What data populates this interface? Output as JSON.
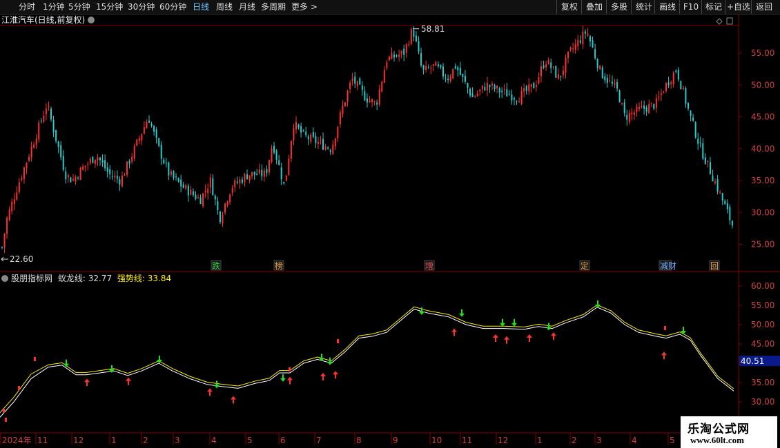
{
  "toolbar": {
    "left_items": [
      "分时",
      "1分钟",
      "5分钟",
      "15分钟",
      "30分钟",
      "60分钟",
      "日线",
      "周线",
      "月线",
      "多周期",
      "更多 >"
    ],
    "active": "日线",
    "right_items": [
      "复权",
      "叠加",
      "多股",
      "统计",
      "画线",
      "F10",
      "标记",
      "+自选",
      "返回"
    ]
  },
  "main_chart": {
    "title": "江淮汽车(日线,前复权)",
    "high_label": "58.81",
    "low_label": "22.60",
    "y_ticks": [
      "55.00",
      "50.00",
      "45.00",
      "40.00",
      "35.00",
      "30.00",
      "25.00"
    ],
    "markers": [
      {
        "text": "跌",
        "color": "#2ecc40"
      },
      {
        "text": "榜",
        "color": "#e8a040"
      },
      {
        "text": "增",
        "color": "#e85050"
      },
      {
        "text": "定",
        "color": "#e8a040"
      },
      {
        "text": "减财",
        "color": "#6ea8ff"
      },
      {
        "text": "回",
        "color": "#e8a040"
      }
    ]
  },
  "indicator": {
    "source": "股朋指标网",
    "line1_name": "蚁龙线:",
    "line1_value": "32.77",
    "line2_name": "强势线:",
    "line2_value": "33.84",
    "y_ticks": [
      "60.00",
      "55.00",
      "50.00",
      "45.00",
      "40.00",
      "35.00",
      "30.00"
    ],
    "cursor_value": "40.51"
  },
  "x_axis": {
    "labels": [
      "2024年",
      "11",
      "12",
      "1",
      "2",
      "3",
      "4",
      "5",
      "6",
      "7",
      "8",
      "9",
      "10",
      "11",
      "12",
      "1",
      "2",
      "3",
      "4",
      "5"
    ]
  },
  "watermark": {
    "line1": "乐淘公式网",
    "line2": "www.60lt.com"
  },
  "colors": {
    "up": "#ff3030",
    "down": "#20d0d0",
    "line1": "#ffffff",
    "line2": "#ffee00",
    "grid": "#880000"
  },
  "chart_data": {
    "type": "candlestick",
    "title": "江淮汽车(日线,前复权)",
    "ylim": [
      22,
      61
    ],
    "price_path": [
      [
        0,
        22.6
      ],
      [
        10,
        29
      ],
      [
        25,
        34
      ],
      [
        45,
        40
      ],
      [
        55,
        43
      ],
      [
        68,
        47
      ],
      [
        80,
        42
      ],
      [
        95,
        36
      ],
      [
        105,
        35
      ],
      [
        120,
        37
      ],
      [
        140,
        39
      ],
      [
        158,
        36
      ],
      [
        175,
        35
      ],
      [
        195,
        40
      ],
      [
        215,
        45
      ],
      [
        230,
        40
      ],
      [
        245,
        36
      ],
      [
        265,
        34
      ],
      [
        290,
        32
      ],
      [
        305,
        35
      ],
      [
        318,
        29
      ],
      [
        335,
        34
      ],
      [
        360,
        36
      ],
      [
        385,
        36
      ],
      [
        395,
        41
      ],
      [
        412,
        34
      ],
      [
        425,
        44
      ],
      [
        440,
        42
      ],
      [
        460,
        41
      ],
      [
        480,
        40
      ],
      [
        495,
        46
      ],
      [
        510,
        51
      ],
      [
        530,
        48
      ],
      [
        545,
        47
      ],
      [
        560,
        54
      ],
      [
        585,
        55
      ],
      [
        598,
        58.8
      ],
      [
        612,
        52
      ],
      [
        630,
        53
      ],
      [
        648,
        51
      ],
      [
        660,
        53
      ],
      [
        685,
        48
      ],
      [
        705,
        50
      ],
      [
        725,
        49
      ],
      [
        750,
        48
      ],
      [
        775,
        50
      ],
      [
        790,
        54
      ],
      [
        810,
        51
      ],
      [
        825,
        55
      ],
      [
        850,
        58.5
      ],
      [
        870,
        52
      ],
      [
        895,
        49
      ],
      [
        905,
        45
      ],
      [
        925,
        46
      ],
      [
        950,
        47
      ],
      [
        965,
        50
      ],
      [
        980,
        52.5
      ],
      [
        1000,
        45
      ],
      [
        1015,
        40
      ],
      [
        1035,
        35
      ],
      [
        1050,
        31
      ],
      [
        1063,
        27.5
      ]
    ],
    "indicator_path": [
      [
        0,
        26
      ],
      [
        20,
        30
      ],
      [
        45,
        36
      ],
      [
        70,
        39
      ],
      [
        90,
        39.5
      ],
      [
        110,
        37
      ],
      [
        125,
        37
      ],
      [
        145,
        37.5
      ],
      [
        165,
        38
      ],
      [
        185,
        36.8
      ],
      [
        205,
        38
      ],
      [
        230,
        40
      ],
      [
        250,
        38
      ],
      [
        275,
        36
      ],
      [
        300,
        34.5
      ],
      [
        320,
        34
      ],
      [
        345,
        33.5
      ],
      [
        370,
        34.8
      ],
      [
        390,
        35.5
      ],
      [
        405,
        37.5
      ],
      [
        420,
        37.5
      ],
      [
        440,
        40
      ],
      [
        460,
        41
      ],
      [
        480,
        40
      ],
      [
        500,
        43
      ],
      [
        520,
        46.5
      ],
      [
        540,
        47
      ],
      [
        560,
        48
      ],
      [
        580,
        51
      ],
      [
        600,
        54
      ],
      [
        620,
        53
      ],
      [
        650,
        52
      ],
      [
        675,
        50
      ],
      [
        700,
        49
      ],
      [
        730,
        49
      ],
      [
        760,
        48.8
      ],
      [
        780,
        49.5
      ],
      [
        800,
        49
      ],
      [
        820,
        50.5
      ],
      [
        845,
        52
      ],
      [
        865,
        54.5
      ],
      [
        885,
        53
      ],
      [
        905,
        50
      ],
      [
        925,
        48
      ],
      [
        950,
        47
      ],
      [
        965,
        46.5
      ],
      [
        985,
        47.5
      ],
      [
        1000,
        46
      ],
      [
        1015,
        42
      ],
      [
        1040,
        36
      ],
      [
        1063,
        32.8
      ]
    ],
    "up_arrows": [
      [
        126,
        36
      ],
      [
        186,
        36.3
      ],
      [
        304,
        33.5
      ],
      [
        338,
        31.5
      ],
      [
        420,
        36.5
      ],
      [
        468,
        37.5
      ],
      [
        486,
        38
      ],
      [
        658,
        49
      ],
      [
        718,
        47.5
      ],
      [
        734,
        47
      ],
      [
        767,
        47.5
      ],
      [
        802,
        48
      ],
      [
        962,
        43
      ]
    ],
    "down_arrows": [
      [
        96,
        39
      ],
      [
        162,
        37.5
      ],
      [
        231,
        40
      ],
      [
        314,
        33.5
      ],
      [
        410,
        35.2
      ],
      [
        466,
        40.5
      ],
      [
        478,
        39.5
      ],
      [
        611,
        52.5
      ],
      [
        669,
        52
      ],
      [
        728,
        49.5
      ],
      [
        745,
        49.5
      ],
      [
        795,
        48.5
      ],
      [
        866,
        54.3
      ],
      [
        990,
        47.5
      ]
    ]
  }
}
